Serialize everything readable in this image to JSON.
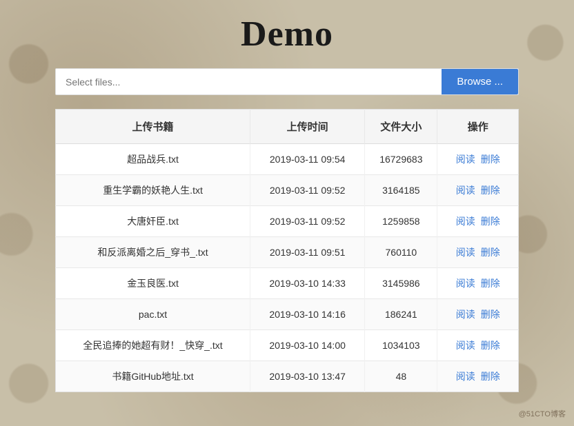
{
  "page": {
    "title": "Demo",
    "watermark": "@51CTO博客"
  },
  "upload_bar": {
    "placeholder": "Select files...",
    "browse_label": "Browse ..."
  },
  "table": {
    "headers": [
      "上传书籍",
      "上传时间",
      "文件大小",
      "操作"
    ],
    "action_read": "阅读",
    "action_delete": "删除",
    "rows": [
      {
        "name": "超品战兵.txt",
        "time": "2019-03-11 09:54",
        "size": "16729683"
      },
      {
        "name": "重生学霸的妖艳人生.txt",
        "time": "2019-03-11 09:52",
        "size": "3164185"
      },
      {
        "name": "大唐奸臣.txt",
        "time": "2019-03-11 09:52",
        "size": "1259858"
      },
      {
        "name": "和反派离婚之后_穿书_.txt",
        "time": "2019-03-11 09:51",
        "size": "760110"
      },
      {
        "name": "金玉良医.txt",
        "time": "2019-03-10 14:33",
        "size": "3145986"
      },
      {
        "name": "pac.txt",
        "time": "2019-03-10 14:16",
        "size": "186241"
      },
      {
        "name": "全民追捧的她超有财！_快穿_.txt",
        "time": "2019-03-10 14:00",
        "size": "1034103"
      },
      {
        "name": "书籍GitHub地址.txt",
        "time": "2019-03-10 13:47",
        "size": "48"
      }
    ]
  }
}
